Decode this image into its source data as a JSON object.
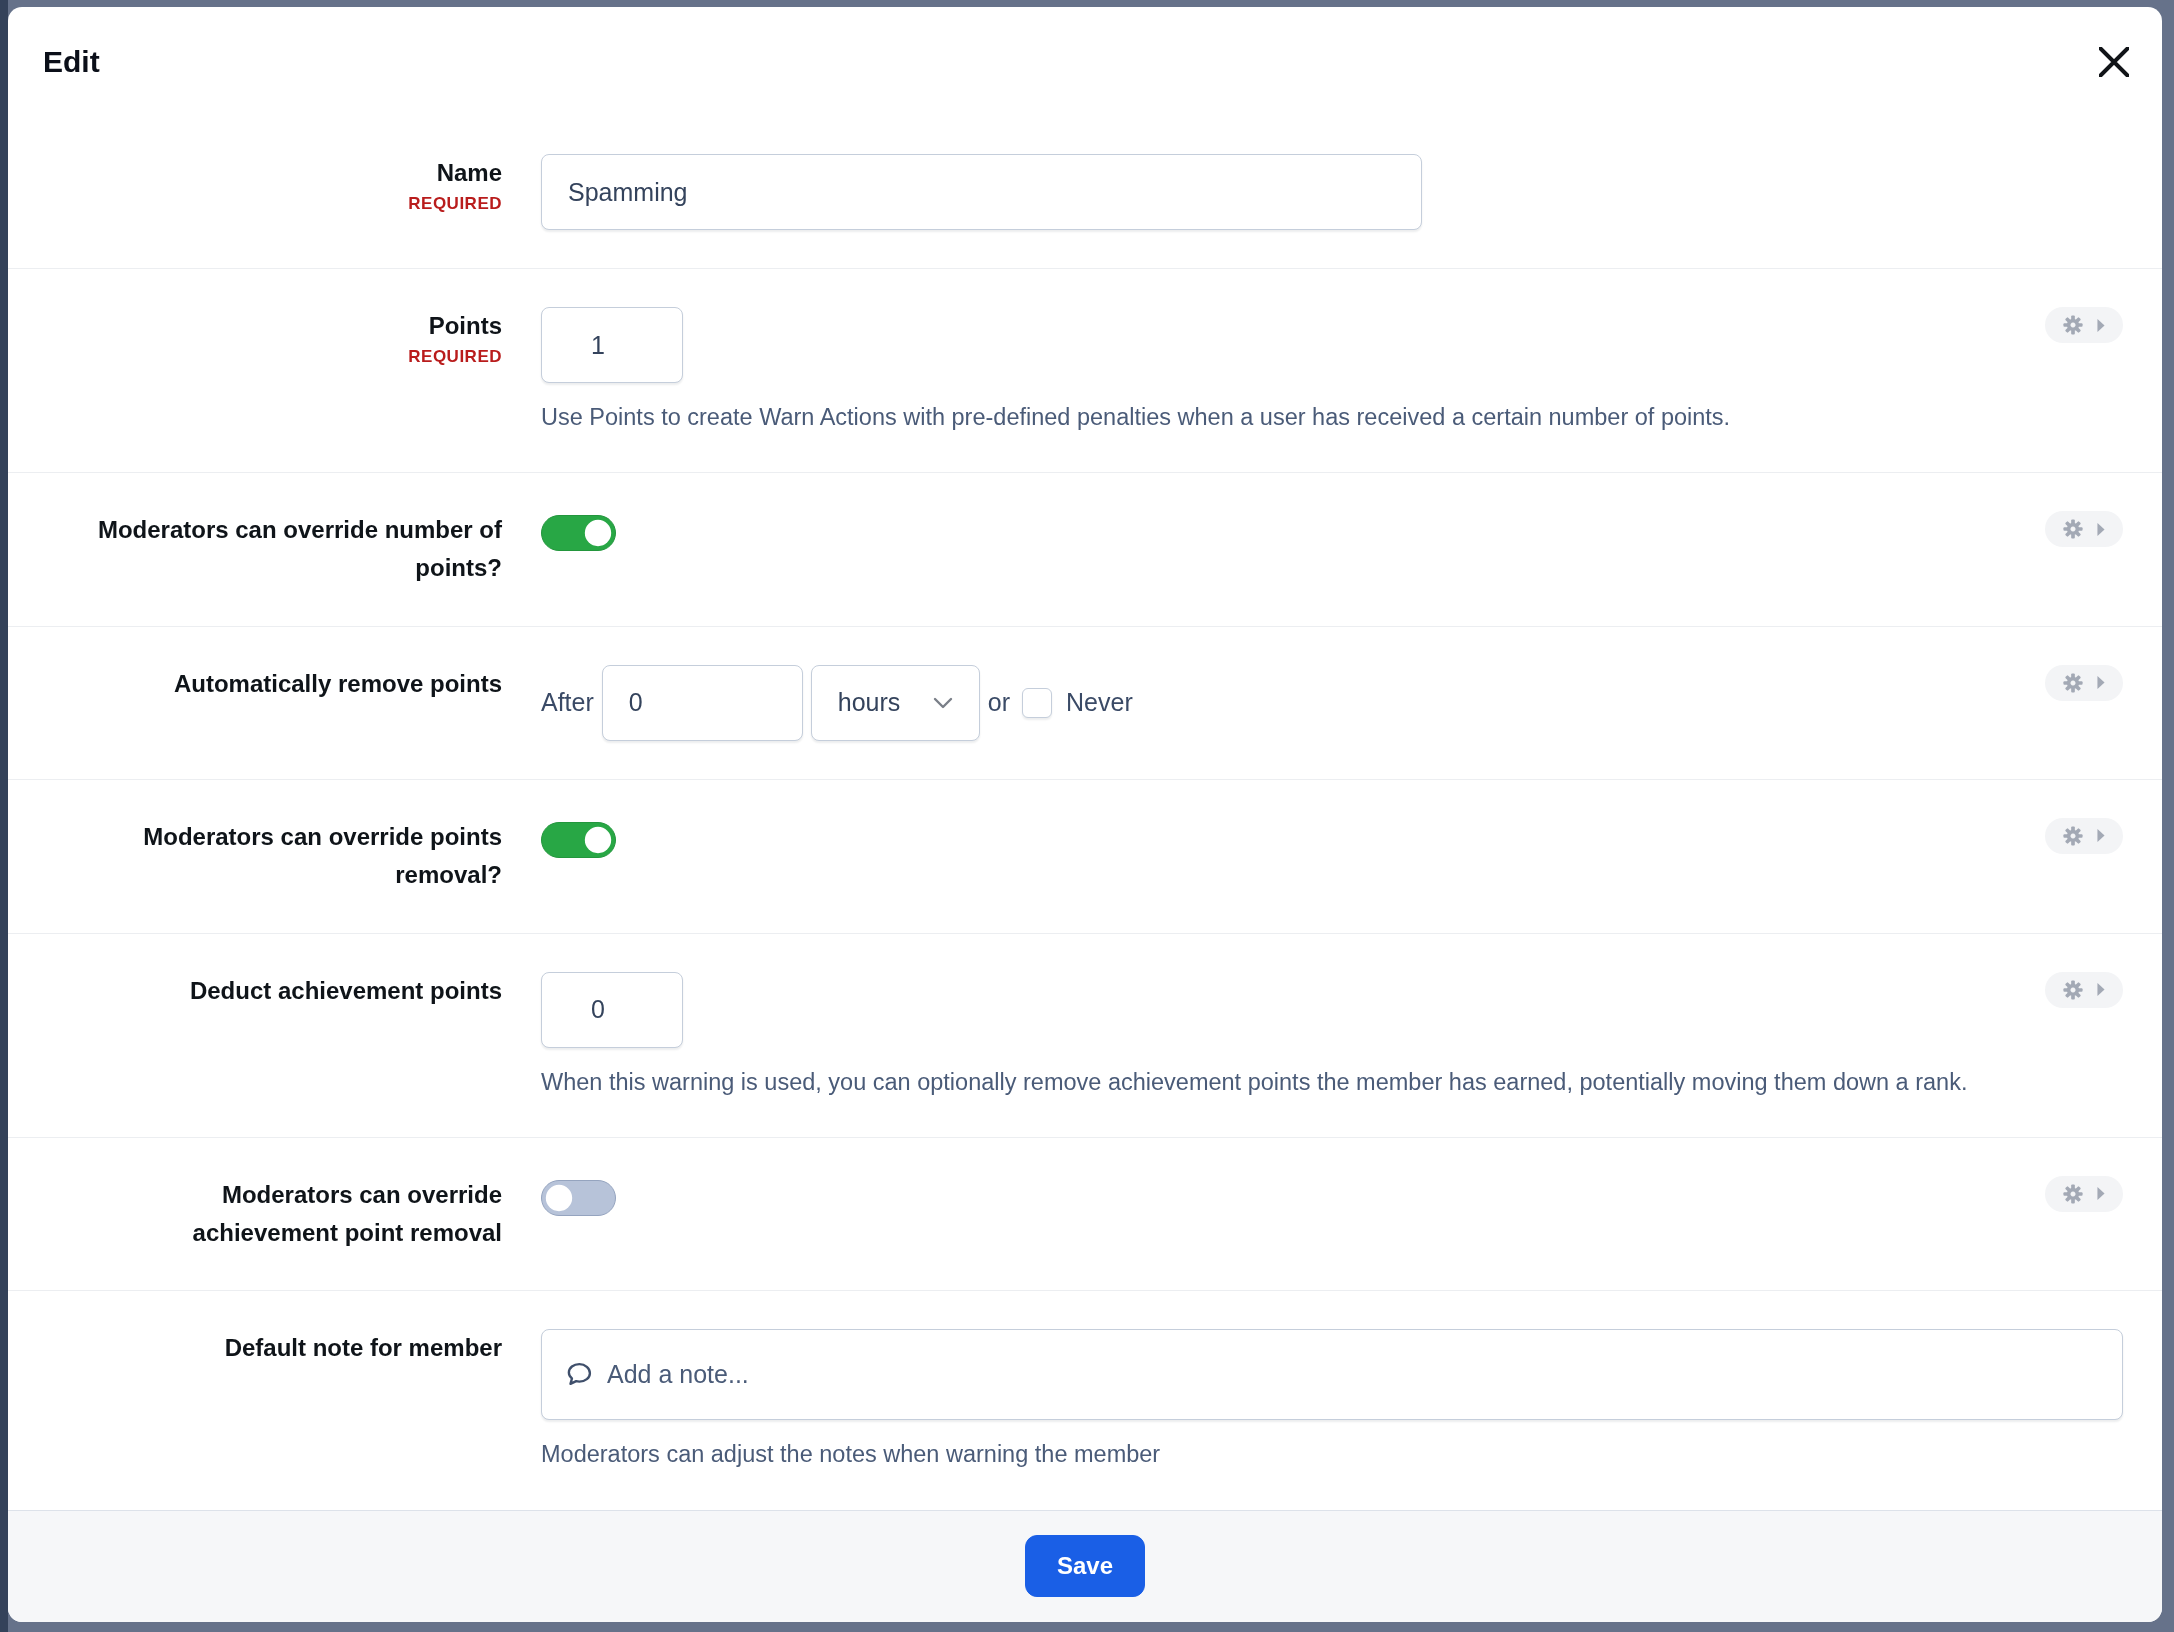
{
  "dialog": {
    "title": "Edit"
  },
  "fields": [
    {
      "kind": "text",
      "label": "Name",
      "required_note": "REQUIRED",
      "value": "Spamming",
      "settings": false
    },
    {
      "kind": "number",
      "label": "Points",
      "required_note": "REQUIRED",
      "value": "1",
      "help": "Use Points to create Warn Actions with pre-defined penalties when a user has received a certain number of points.",
      "settings": true
    },
    {
      "kind": "toggle",
      "label": "Moderators can override number of points?",
      "on": true,
      "settings": true
    },
    {
      "kind": "duration",
      "label": "Automatically remove points",
      "prefix": "After",
      "value": "0",
      "unit": "hours",
      "joiner": "or",
      "never": {
        "label": "Never",
        "checked": false
      },
      "settings": true
    },
    {
      "kind": "toggle",
      "label": "Moderators can override points removal?",
      "on": true,
      "settings": true
    },
    {
      "kind": "number",
      "label": "Deduct achievement points",
      "value": "0",
      "help": "When this warning is used, you can optionally remove achievement points the member has earned, potentially moving them down a rank.",
      "settings": true
    },
    {
      "kind": "toggle",
      "label": "Moderators can override achievement point removal",
      "on": false,
      "settings": true
    },
    {
      "kind": "note",
      "label": "Default note for member",
      "placeholder": "Add a note...",
      "help": "Moderators can adjust the notes when warning the member",
      "settings": false
    }
  ],
  "footer": {
    "save_button": "Save"
  }
}
